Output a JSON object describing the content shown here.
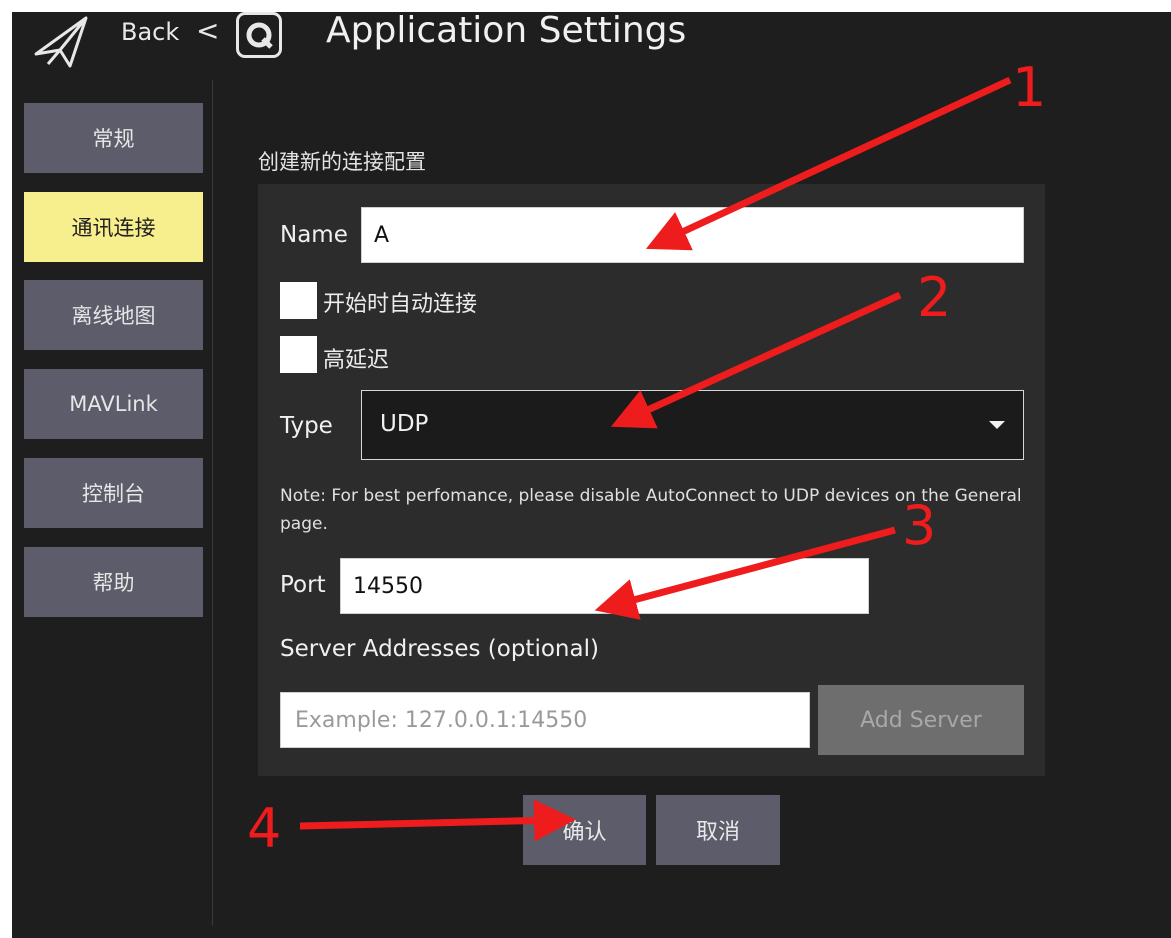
{
  "header": {
    "back_label": "Back",
    "lt_glyph": "<",
    "title": "Application Settings",
    "icons": [
      "paper-plane-icon",
      "app-logo-icon"
    ]
  },
  "sidebar": {
    "items": [
      {
        "label": "常规",
        "active": false
      },
      {
        "label": "通讯连接",
        "active": true
      },
      {
        "label": "离线地图",
        "active": false
      },
      {
        "label": "MAVLink",
        "active": false
      },
      {
        "label": "控制台",
        "active": false
      },
      {
        "label": "帮助",
        "active": false
      }
    ]
  },
  "form": {
    "section_title": "创建新的连接配置",
    "name_label": "Name",
    "name_value": "A",
    "autoconnect_label": "开始时自动连接",
    "high_latency_label": "高延迟",
    "type_label": "Type",
    "type_value": "UDP",
    "note": "Note: For best perfomance, please disable AutoConnect to UDP devices on the General page.",
    "port_label": "Port",
    "port_value": "14550",
    "server_label": "Server Addresses (optional)",
    "server_placeholder": "Example: 127.0.0.1:14550",
    "add_server_label": "Add Server"
  },
  "actions": {
    "confirm_label": "确认",
    "cancel_label": "取消"
  },
  "annotations": {
    "marker1": "1",
    "marker2": "2",
    "marker3": "3",
    "marker4": "4"
  },
  "colors": {
    "background": "#1e1e1e",
    "nav_button": "#5c5c6a",
    "nav_active": "#f7ee8d",
    "panel": "#2c2c2c",
    "annotation_red": "#ee1c1c"
  }
}
